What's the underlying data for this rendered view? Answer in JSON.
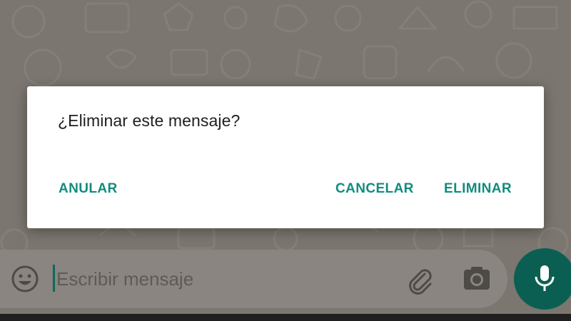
{
  "dialog": {
    "title": "¿Eliminar este mensaje?",
    "buttons": {
      "anular": "ANULAR",
      "cancelar": "CANCELAR",
      "eliminar": "ELIMINAR"
    }
  },
  "composer": {
    "placeholder": "Escribir mensaje",
    "value": ""
  },
  "icons": {
    "emoji": "emoji-icon",
    "attach": "paperclip-icon",
    "camera": "camera-icon",
    "mic": "microphone-icon"
  },
  "colors": {
    "accent": "#128c7e",
    "mic_button": "#0b5f52",
    "dimmed_background": "#7b766f",
    "dialog_background": "#ffffff",
    "title_text": "#202020"
  }
}
